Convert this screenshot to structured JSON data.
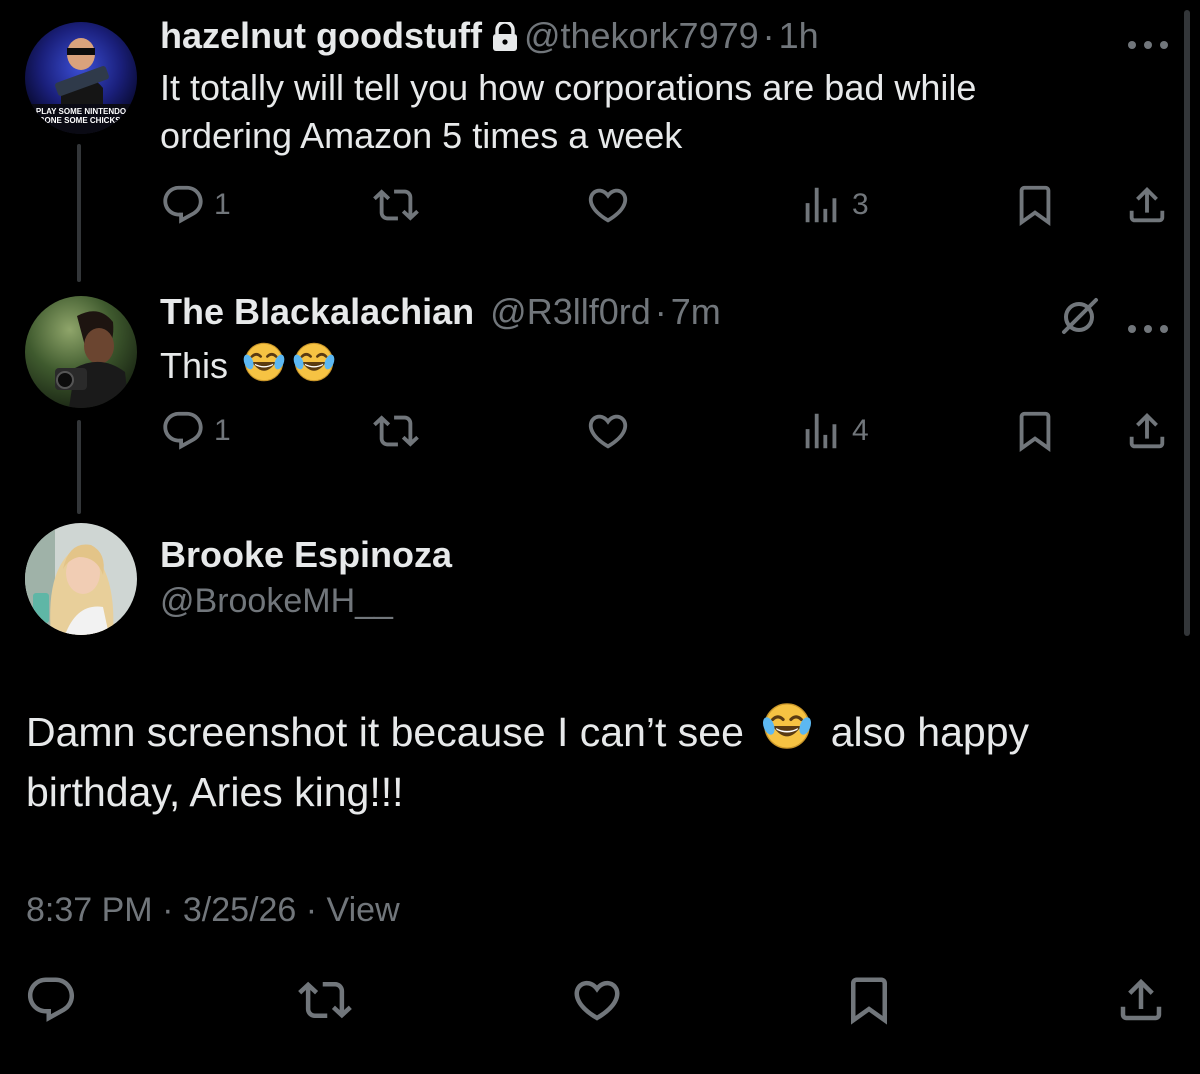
{
  "reply1": {
    "display_name": "hazelnut goodstuff",
    "handle": "@thekork7979",
    "separator": "·",
    "time": "1h",
    "avatar_text_line1": "PLAY SOME NINTENDO",
    "avatar_text_line2": "BONE SOME CHICKS!",
    "text_line1": "It totally will tell you how corporations are bad while",
    "text_line2": "ordering Amazon 5 times a week",
    "reply_count": "1",
    "views_count": "3"
  },
  "reply2": {
    "display_name": "The Blackalachian",
    "handle": "@R3llf0rd",
    "separator": "·",
    "time": "7m",
    "text": "This",
    "reply_count": "1",
    "views_count": "4"
  },
  "main_tweet": {
    "display_name": "Brooke Espinoza",
    "handle": "@BrookeMH__",
    "text_part1": "Damn screenshot it because I can’t see",
    "text_part2": "also happy",
    "text_line2": "birthday, Aries king!!!",
    "time": "8:37 PM",
    "date": "3/25/26",
    "separator": "·",
    "view_label": "View"
  },
  "icons": {
    "lock": "lock-icon",
    "more": "more-horizontal-icon",
    "reply": "reply-bubble-icon",
    "retweet": "retweet-icon",
    "like": "heart-icon",
    "views": "bar-chart-icon",
    "bookmark": "bookmark-icon",
    "share": "share-icon",
    "grok": "grok-slash-icon",
    "emoji": "face-with-tears-of-joy"
  },
  "colors": {
    "background": "#000000",
    "text_primary": "#e7e9ea",
    "text_secondary": "#71767b",
    "thread_line": "#333639"
  }
}
